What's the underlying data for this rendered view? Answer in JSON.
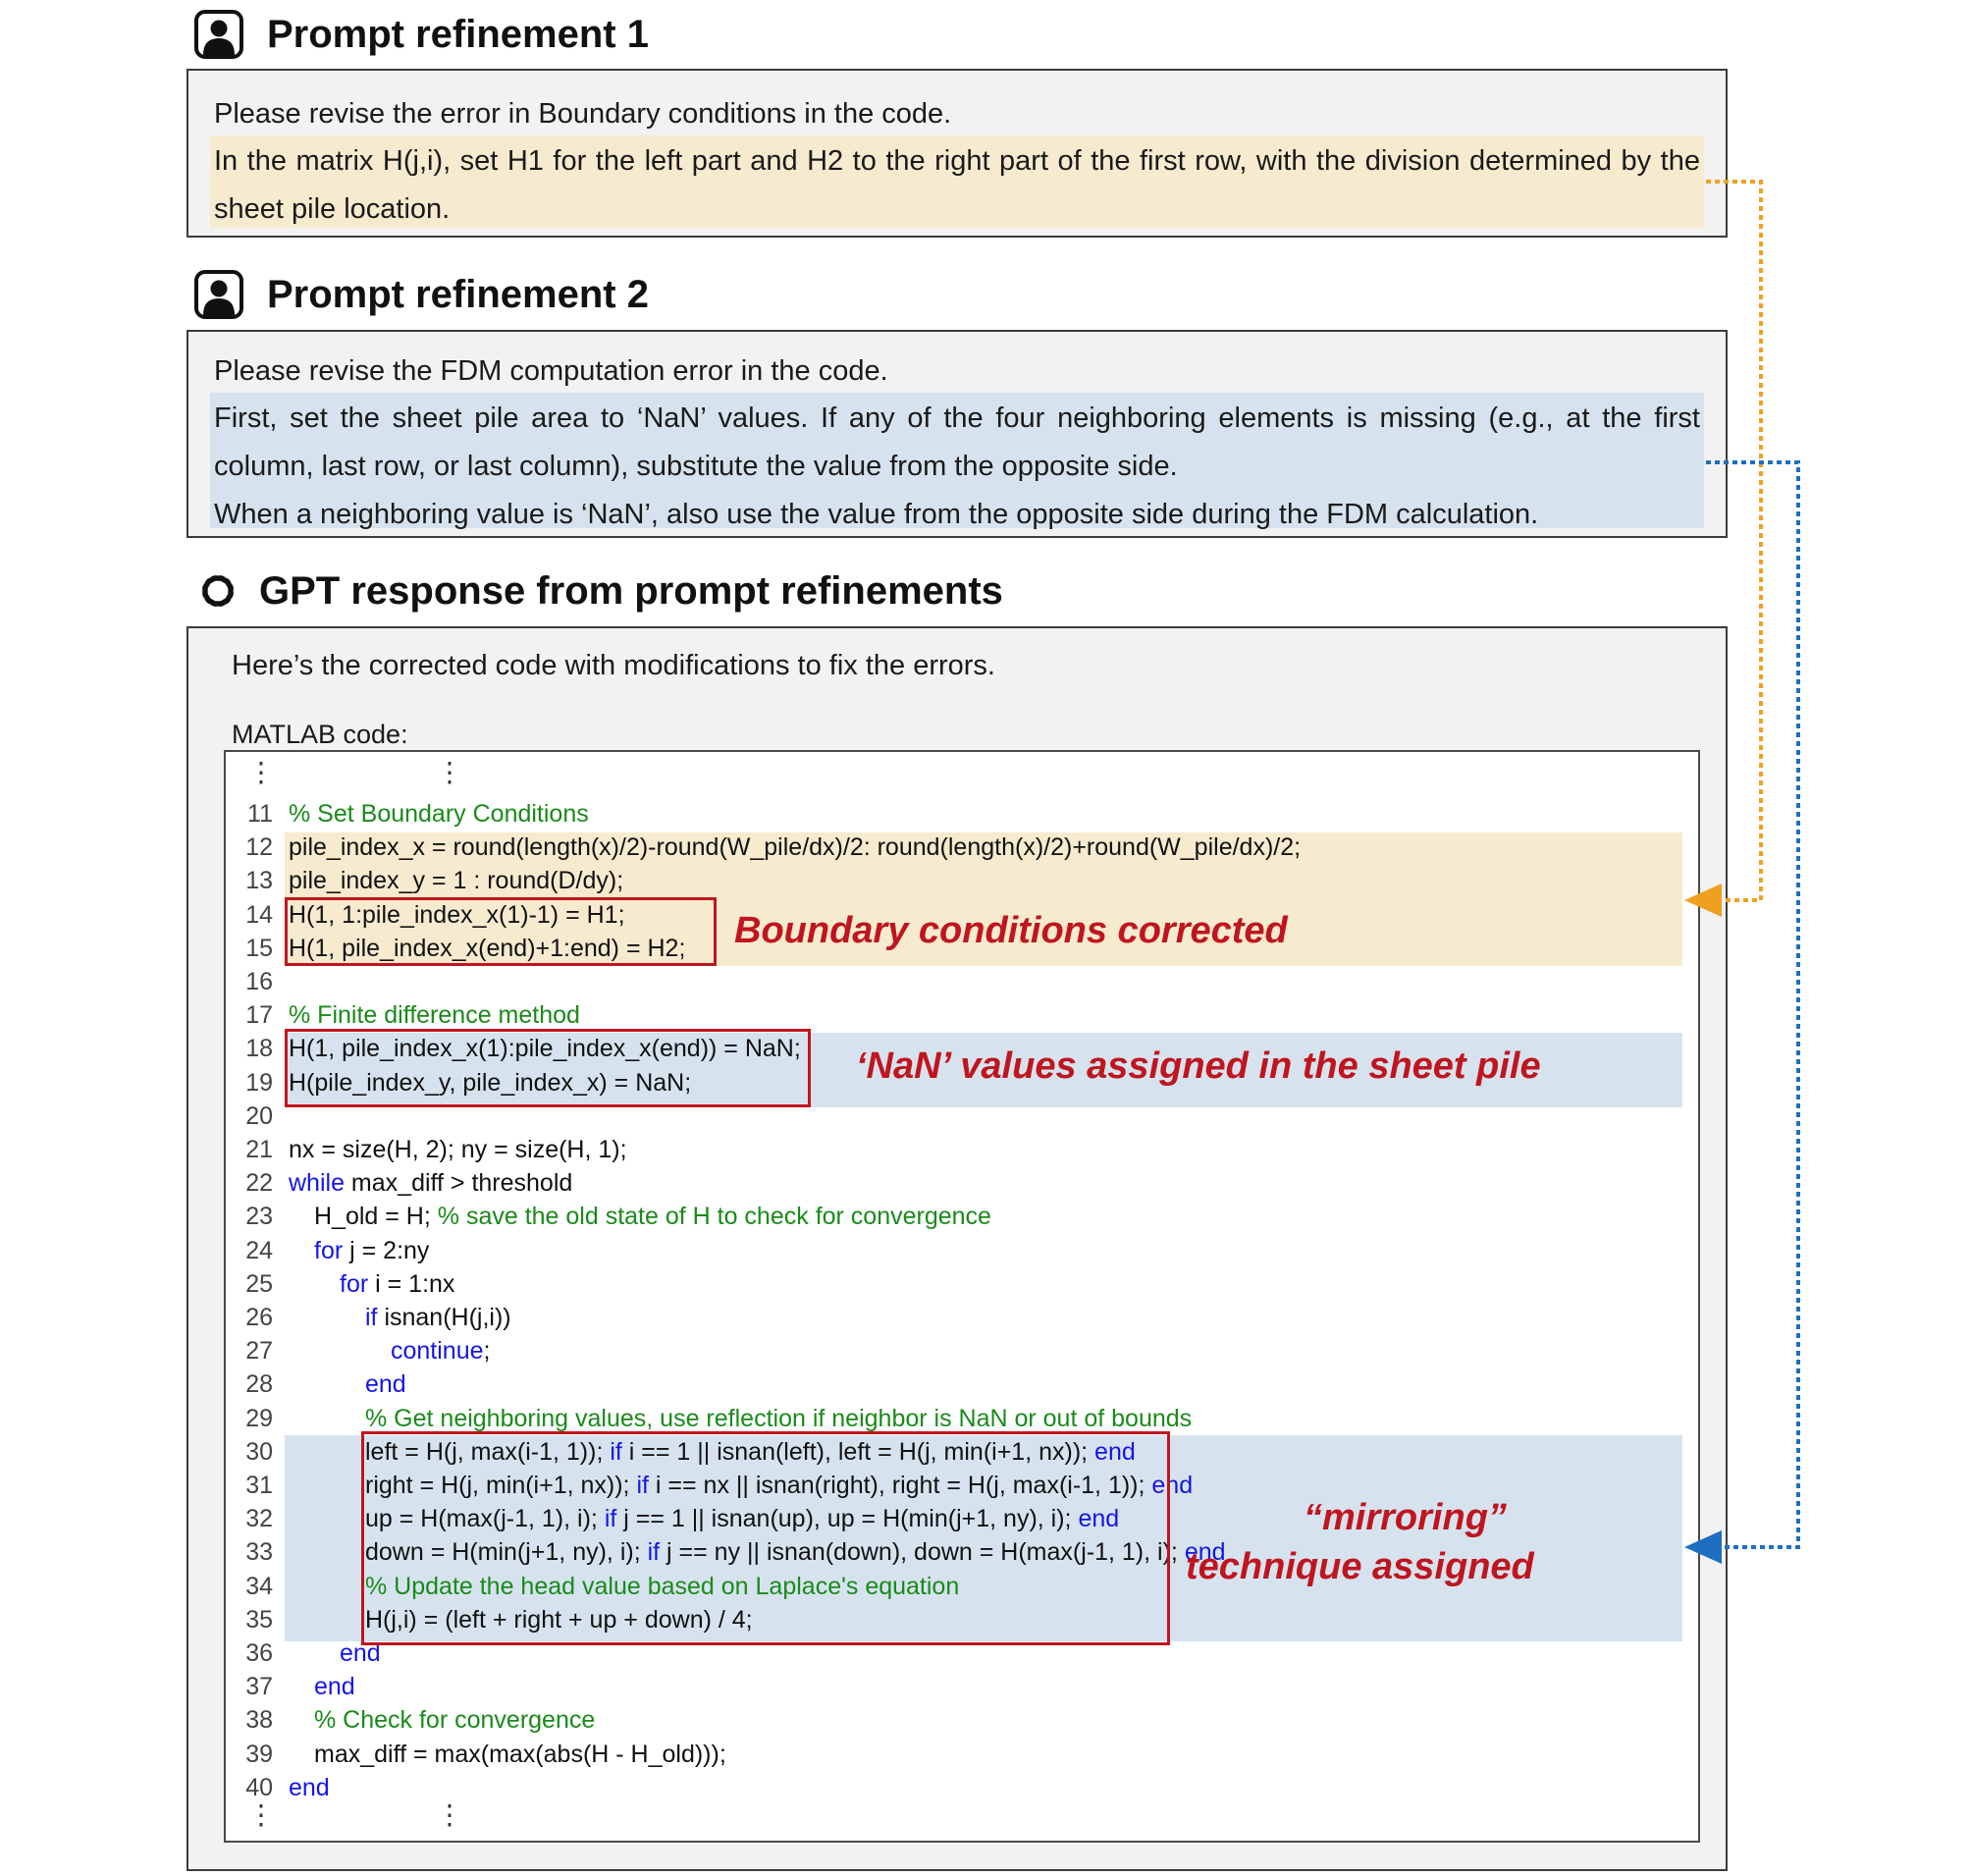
{
  "refinement1": {
    "title": "Prompt refinement 1",
    "line1": "Please revise the error in Boundary conditions in the code.",
    "highlight": "In the matrix H(j,i), set H1 for the left part and H2 to the right part of the first row, with the division determined by the sheet pile location."
  },
  "refinement2": {
    "title": "Prompt refinement 2",
    "line1": "Please revise the FDM computation error in the code.",
    "highlight_a": "First, set the sheet pile area to ‘NaN’ values. If any of the four neighboring elements is missing (e.g., at the first column, last row, or last column), substitute the value from the opposite side.",
    "highlight_b": "When a neighboring value is ‘NaN’, also use the value from the opposite side during the FDM calculation."
  },
  "response": {
    "title": "GPT response from prompt refinements",
    "intro": "Here’s the corrected code with modifications to fix the errors.",
    "code_label": "MATLAB code:",
    "ellipsis": "⋮",
    "lines": [
      {
        "n": "11",
        "indent": 0,
        "parts": [
          {
            "t": "% Set Boundary Conditions",
            "c": "cm"
          }
        ]
      },
      {
        "n": "12",
        "indent": 0,
        "parts": [
          {
            "t": "pile_index_x = round(length(x)/2)-round(W_pile/dx)/2: round(length(x)/2)+round(W_pile/dx)/2;",
            "c": ""
          }
        ]
      },
      {
        "n": "13",
        "indent": 0,
        "parts": [
          {
            "t": "pile_index_y = 1 : round(D/dy);",
            "c": ""
          }
        ]
      },
      {
        "n": "14",
        "indent": 0,
        "parts": [
          {
            "t": "H(1, 1:pile_index_x(1)-1) = H1;",
            "c": ""
          }
        ]
      },
      {
        "n": "15",
        "indent": 0,
        "parts": [
          {
            "t": "H(1, pile_index_x(end)+1:end) = H2;",
            "c": ""
          }
        ]
      },
      {
        "n": "16",
        "indent": 0,
        "parts": []
      },
      {
        "n": "17",
        "indent": 0,
        "parts": [
          {
            "t": "% Finite difference method",
            "c": "cm"
          }
        ]
      },
      {
        "n": "18",
        "indent": 0,
        "parts": [
          {
            "t": "H(1, pile_index_x(1):pile_index_x(end)) = NaN;",
            "c": ""
          }
        ]
      },
      {
        "n": "19",
        "indent": 0,
        "parts": [
          {
            "t": "H(pile_index_y, pile_index_x) = NaN;",
            "c": ""
          }
        ]
      },
      {
        "n": "20",
        "indent": 0,
        "parts": []
      },
      {
        "n": "21",
        "indent": 0,
        "parts": [
          {
            "t": "nx = size(H, 2); ny = size(H, 1);",
            "c": ""
          }
        ]
      },
      {
        "n": "22",
        "indent": 0,
        "parts": [
          {
            "t": "while",
            "c": "kw"
          },
          {
            "t": " max_diff > threshold",
            "c": ""
          }
        ]
      },
      {
        "n": "23",
        "indent": 1,
        "parts": [
          {
            "t": "H_old = H; ",
            "c": ""
          },
          {
            "t": "% save the old state of H to check for convergence",
            "c": "cm"
          }
        ]
      },
      {
        "n": "24",
        "indent": 1,
        "parts": [
          {
            "t": "for",
            "c": "kw"
          },
          {
            "t": " j = 2:ny",
            "c": ""
          }
        ]
      },
      {
        "n": "25",
        "indent": 2,
        "parts": [
          {
            "t": "for",
            "c": "kw"
          },
          {
            "t": " i = 1:nx",
            "c": ""
          }
        ]
      },
      {
        "n": "26",
        "indent": 3,
        "parts": [
          {
            "t": "if",
            "c": "kw"
          },
          {
            "t": " isnan(H(j,i))",
            "c": ""
          }
        ]
      },
      {
        "n": "27",
        "indent": 4,
        "parts": [
          {
            "t": "continue",
            "c": "kw"
          },
          {
            "t": ";",
            "c": ""
          }
        ]
      },
      {
        "n": "28",
        "indent": 3,
        "parts": [
          {
            "t": "end",
            "c": "kw"
          }
        ]
      },
      {
        "n": "29",
        "indent": 3,
        "parts": [
          {
            "t": "% Get neighboring values, use reflection if neighbor is NaN or out of bounds",
            "c": "cm"
          }
        ]
      },
      {
        "n": "30",
        "indent": 3,
        "parts": [
          {
            "t": "left = H(j, max(i-1, 1)); ",
            "c": ""
          },
          {
            "t": "if",
            "c": "kw"
          },
          {
            "t": " i == 1 || isnan(left), left = H(j, min(i+1, nx)); ",
            "c": ""
          },
          {
            "t": "end",
            "c": "kw"
          }
        ]
      },
      {
        "n": "31",
        "indent": 3,
        "parts": [
          {
            "t": "right = H(j, min(i+1, nx)); ",
            "c": ""
          },
          {
            "t": "if",
            "c": "kw"
          },
          {
            "t": " i == nx || isnan(right), right = H(j, max(i-1, 1)); ",
            "c": ""
          },
          {
            "t": "end",
            "c": "kw"
          }
        ]
      },
      {
        "n": "32",
        "indent": 3,
        "parts": [
          {
            "t": "up = H(max(j-1, 1), i); ",
            "c": ""
          },
          {
            "t": "if",
            "c": "kw"
          },
          {
            "t": " j == 1 || isnan(up), up = H(min(j+1, ny), i); ",
            "c": ""
          },
          {
            "t": "end",
            "c": "kw"
          }
        ]
      },
      {
        "n": "33",
        "indent": 3,
        "parts": [
          {
            "t": "down = H(min(j+1, ny), i); ",
            "c": ""
          },
          {
            "t": "if",
            "c": "kw"
          },
          {
            "t": " j == ny || isnan(down), down = H(max(j-1, 1), i); ",
            "c": ""
          },
          {
            "t": "end",
            "c": "kw"
          }
        ]
      },
      {
        "n": "34",
        "indent": 3,
        "parts": [
          {
            "t": "% Update the head value based on Laplace's equation",
            "c": "cm"
          }
        ]
      },
      {
        "n": "35",
        "indent": 3,
        "parts": [
          {
            "t": "H(j,i) = (left + right + up + down) / 4;",
            "c": ""
          }
        ]
      },
      {
        "n": "36",
        "indent": 2,
        "parts": [
          {
            "t": "end",
            "c": "kw"
          }
        ]
      },
      {
        "n": "37",
        "indent": 1,
        "parts": [
          {
            "t": "end",
            "c": "kw"
          }
        ]
      },
      {
        "n": "38",
        "indent": 1,
        "parts": [
          {
            "t": "% Check for convergence",
            "c": "cm"
          }
        ]
      },
      {
        "n": "39",
        "indent": 1,
        "parts": [
          {
            "t": "max_diff = max(max(abs(H - H_old)));",
            "c": ""
          }
        ]
      },
      {
        "n": "40",
        "indent": 0,
        "parts": [
          {
            "t": "end",
            "c": "kw"
          }
        ]
      }
    ]
  },
  "annotations": {
    "boundary": "Boundary conditions corrected",
    "nan": "‘NaN’ values assigned in the sheet pile",
    "mirroring_line1": "“mirroring”",
    "mirroring_line2": "technique assigned"
  },
  "colors": {
    "highlight_yellow": "#f6ebcf",
    "highlight_blue": "#d6e3ef",
    "annotation_red": "#c0151e",
    "keyword_blue": "#1515e6",
    "comment_green": "#1a8a1a",
    "arrow_orange": "#f0a020",
    "arrow_blue": "#1e6fc0"
  }
}
